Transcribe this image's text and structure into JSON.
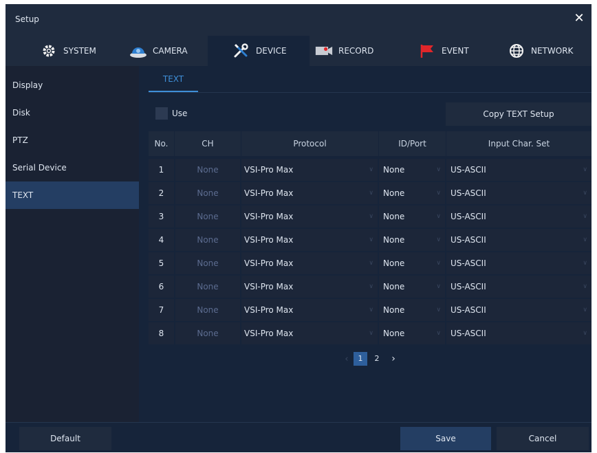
{
  "window": {
    "title": "Setup",
    "close_label": "✕"
  },
  "tabs": [
    {
      "label": "SYSTEM",
      "icon": "gear-icon"
    },
    {
      "label": "CAMERA",
      "icon": "camera-icon"
    },
    {
      "label": "DEVICE",
      "icon": "tools-icon"
    },
    {
      "label": "RECORD",
      "icon": "record-icon"
    },
    {
      "label": "EVENT",
      "icon": "flag-icon"
    },
    {
      "label": "NETWORK",
      "icon": "globe-icon"
    }
  ],
  "active_tab": "DEVICE",
  "sidebar": {
    "items": [
      {
        "label": "Display"
      },
      {
        "label": "Disk"
      },
      {
        "label": "PTZ"
      },
      {
        "label": "Serial Device"
      },
      {
        "label": "TEXT"
      }
    ],
    "active": "TEXT"
  },
  "main": {
    "subtab": "TEXT",
    "use_label": "Use",
    "use_checked": false,
    "copy_button": "Copy TEXT Setup",
    "columns": {
      "no": "No.",
      "ch": "CH",
      "protocol": "Protocol",
      "idport": "ID/Port",
      "charset": "Input Char. Set"
    },
    "rows": [
      {
        "no": "1",
        "ch": "None",
        "protocol": "VSI-Pro Max",
        "idport": "None",
        "charset": "US-ASCII"
      },
      {
        "no": "2",
        "ch": "None",
        "protocol": "VSI-Pro Max",
        "idport": "None",
        "charset": "US-ASCII"
      },
      {
        "no": "3",
        "ch": "None",
        "protocol": "VSI-Pro Max",
        "idport": "None",
        "charset": "US-ASCII"
      },
      {
        "no": "4",
        "ch": "None",
        "protocol": "VSI-Pro Max",
        "idport": "None",
        "charset": "US-ASCII"
      },
      {
        "no": "5",
        "ch": "None",
        "protocol": "VSI-Pro Max",
        "idport": "None",
        "charset": "US-ASCII"
      },
      {
        "no": "6",
        "ch": "None",
        "protocol": "VSI-Pro Max",
        "idport": "None",
        "charset": "US-ASCII"
      },
      {
        "no": "7",
        "ch": "None",
        "protocol": "VSI-Pro Max",
        "idport": "None",
        "charset": "US-ASCII"
      },
      {
        "no": "8",
        "ch": "None",
        "protocol": "VSI-Pro Max",
        "idport": "None",
        "charset": "US-ASCII"
      }
    ],
    "pagination": {
      "prev": "‹",
      "pages": [
        "1",
        "2"
      ],
      "current": "1",
      "next": "›"
    }
  },
  "footer": {
    "default_label": "Default",
    "save_label": "Save",
    "cancel_label": "Cancel"
  },
  "colors": {
    "accent": "#3f8fd8",
    "background": "#16243a",
    "active_side": "#243e63",
    "save_button": "#243e63"
  }
}
